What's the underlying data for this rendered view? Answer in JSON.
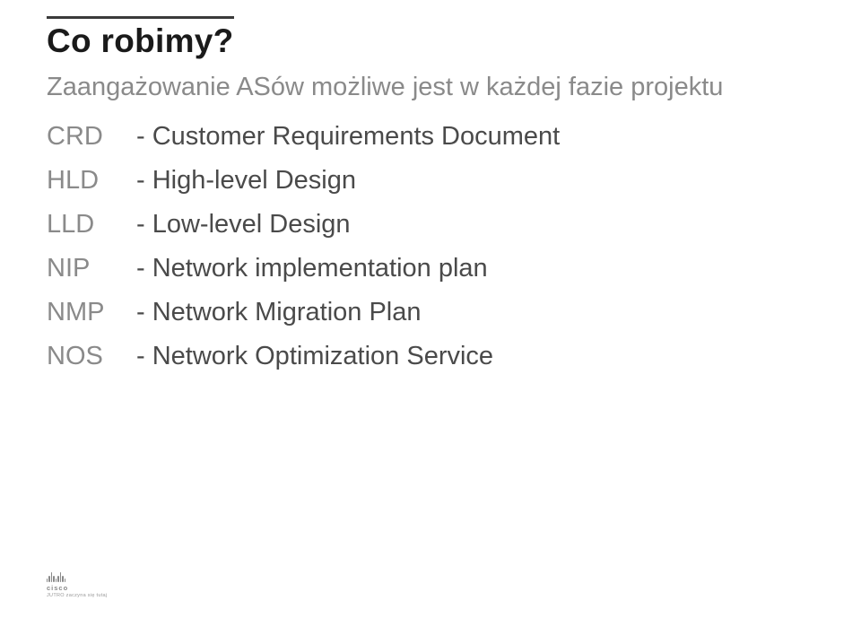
{
  "title": "Co robimy?",
  "subtitle": "Zaangażowanie ASów możliwe jest w każdej fazie projektu",
  "items": [
    {
      "abbr": "CRD",
      "desc": "- Customer Requirements Document"
    },
    {
      "abbr": "HLD",
      "desc": "- High-level Design"
    },
    {
      "abbr": "LLD",
      "desc": "- Low-level Design"
    },
    {
      "abbr": "NIP",
      "desc": "- Network implementation plan"
    },
    {
      "abbr": "NMP",
      "desc": "- Network Migration Plan"
    },
    {
      "abbr": "NOS",
      "desc": "- Network Optimization Service"
    }
  ],
  "footer": {
    "brand": "cisco",
    "tagline": "JUTRO zaczyna się tutaj"
  }
}
